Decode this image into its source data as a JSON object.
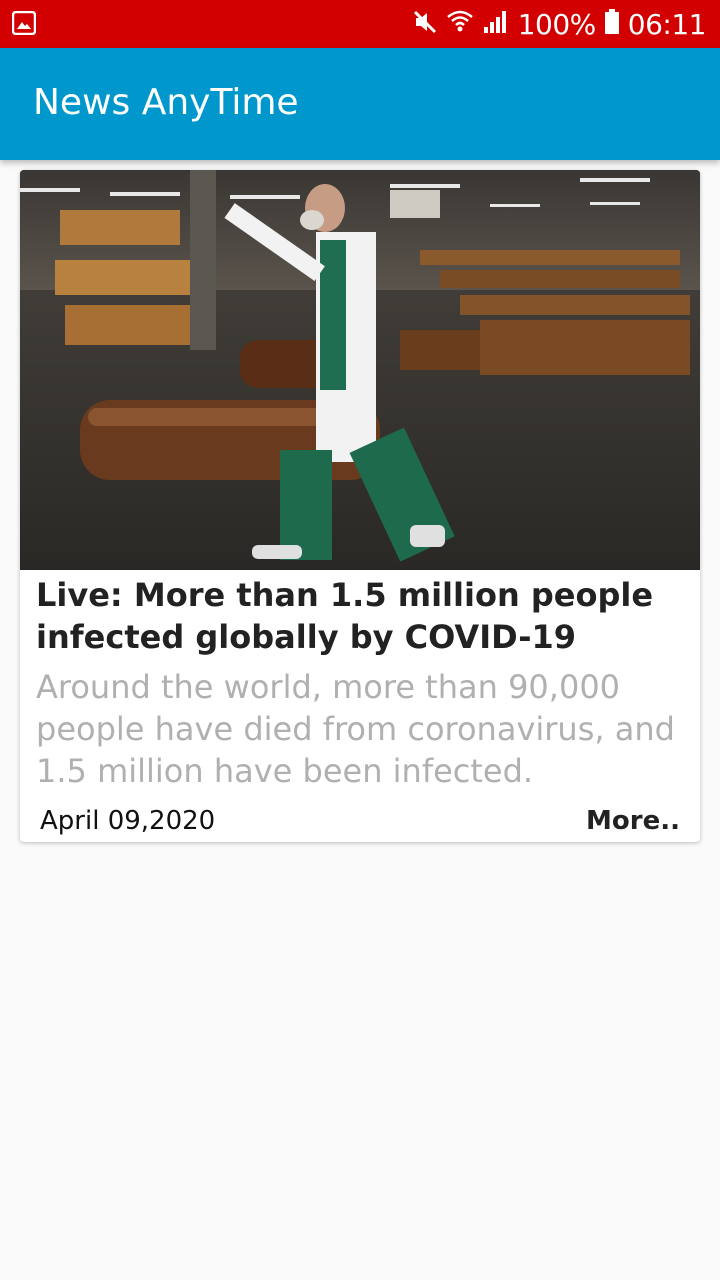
{
  "status_bar": {
    "battery_percent": "100%",
    "time": "06:11",
    "background_color": "#d20000",
    "icons": [
      "image-notification-icon",
      "mute-icon",
      "wifi-icon",
      "signal-icon",
      "battery-icon"
    ]
  },
  "app_bar": {
    "title": "News AnyTime",
    "background_color": "#0098cc"
  },
  "articles": [
    {
      "image": "photo of a man in a white coat and face mask walking among coffins in a hall",
      "title": "Live: More than 1.5 million people infected globally by COVID-19",
      "summary": "Around the world, more than 90,000 people have died from coronavirus, and 1.5 million have been infected.",
      "date": "April 09,2020",
      "more_label": "More.."
    }
  ]
}
